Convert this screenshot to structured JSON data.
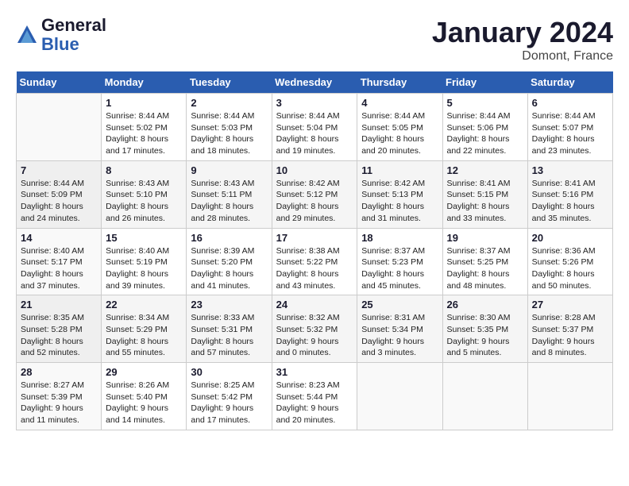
{
  "header": {
    "logo_line1": "General",
    "logo_line2": "Blue",
    "month": "January 2024",
    "location": "Domont, France"
  },
  "columns": [
    "Sunday",
    "Monday",
    "Tuesday",
    "Wednesday",
    "Thursday",
    "Friday",
    "Saturday"
  ],
  "rows": [
    [
      {
        "day": "",
        "sunrise": "",
        "sunset": "",
        "daylight": ""
      },
      {
        "day": "1",
        "sunrise": "Sunrise: 8:44 AM",
        "sunset": "Sunset: 5:02 PM",
        "daylight": "Daylight: 8 hours and 17 minutes."
      },
      {
        "day": "2",
        "sunrise": "Sunrise: 8:44 AM",
        "sunset": "Sunset: 5:03 PM",
        "daylight": "Daylight: 8 hours and 18 minutes."
      },
      {
        "day": "3",
        "sunrise": "Sunrise: 8:44 AM",
        "sunset": "Sunset: 5:04 PM",
        "daylight": "Daylight: 8 hours and 19 minutes."
      },
      {
        "day": "4",
        "sunrise": "Sunrise: 8:44 AM",
        "sunset": "Sunset: 5:05 PM",
        "daylight": "Daylight: 8 hours and 20 minutes."
      },
      {
        "day": "5",
        "sunrise": "Sunrise: 8:44 AM",
        "sunset": "Sunset: 5:06 PM",
        "daylight": "Daylight: 8 hours and 22 minutes."
      },
      {
        "day": "6",
        "sunrise": "Sunrise: 8:44 AM",
        "sunset": "Sunset: 5:07 PM",
        "daylight": "Daylight: 8 hours and 23 minutes."
      }
    ],
    [
      {
        "day": "7",
        "sunrise": "Sunrise: 8:44 AM",
        "sunset": "Sunset: 5:09 PM",
        "daylight": "Daylight: 8 hours and 24 minutes."
      },
      {
        "day": "8",
        "sunrise": "Sunrise: 8:43 AM",
        "sunset": "Sunset: 5:10 PM",
        "daylight": "Daylight: 8 hours and 26 minutes."
      },
      {
        "day": "9",
        "sunrise": "Sunrise: 8:43 AM",
        "sunset": "Sunset: 5:11 PM",
        "daylight": "Daylight: 8 hours and 28 minutes."
      },
      {
        "day": "10",
        "sunrise": "Sunrise: 8:42 AM",
        "sunset": "Sunset: 5:12 PM",
        "daylight": "Daylight: 8 hours and 29 minutes."
      },
      {
        "day": "11",
        "sunrise": "Sunrise: 8:42 AM",
        "sunset": "Sunset: 5:13 PM",
        "daylight": "Daylight: 8 hours and 31 minutes."
      },
      {
        "day": "12",
        "sunrise": "Sunrise: 8:41 AM",
        "sunset": "Sunset: 5:15 PM",
        "daylight": "Daylight: 8 hours and 33 minutes."
      },
      {
        "day": "13",
        "sunrise": "Sunrise: 8:41 AM",
        "sunset": "Sunset: 5:16 PM",
        "daylight": "Daylight: 8 hours and 35 minutes."
      }
    ],
    [
      {
        "day": "14",
        "sunrise": "Sunrise: 8:40 AM",
        "sunset": "Sunset: 5:17 PM",
        "daylight": "Daylight: 8 hours and 37 minutes."
      },
      {
        "day": "15",
        "sunrise": "Sunrise: 8:40 AM",
        "sunset": "Sunset: 5:19 PM",
        "daylight": "Daylight: 8 hours and 39 minutes."
      },
      {
        "day": "16",
        "sunrise": "Sunrise: 8:39 AM",
        "sunset": "Sunset: 5:20 PM",
        "daylight": "Daylight: 8 hours and 41 minutes."
      },
      {
        "day": "17",
        "sunrise": "Sunrise: 8:38 AM",
        "sunset": "Sunset: 5:22 PM",
        "daylight": "Daylight: 8 hours and 43 minutes."
      },
      {
        "day": "18",
        "sunrise": "Sunrise: 8:37 AM",
        "sunset": "Sunset: 5:23 PM",
        "daylight": "Daylight: 8 hours and 45 minutes."
      },
      {
        "day": "19",
        "sunrise": "Sunrise: 8:37 AM",
        "sunset": "Sunset: 5:25 PM",
        "daylight": "Daylight: 8 hours and 48 minutes."
      },
      {
        "day": "20",
        "sunrise": "Sunrise: 8:36 AM",
        "sunset": "Sunset: 5:26 PM",
        "daylight": "Daylight: 8 hours and 50 minutes."
      }
    ],
    [
      {
        "day": "21",
        "sunrise": "Sunrise: 8:35 AM",
        "sunset": "Sunset: 5:28 PM",
        "daylight": "Daylight: 8 hours and 52 minutes."
      },
      {
        "day": "22",
        "sunrise": "Sunrise: 8:34 AM",
        "sunset": "Sunset: 5:29 PM",
        "daylight": "Daylight: 8 hours and 55 minutes."
      },
      {
        "day": "23",
        "sunrise": "Sunrise: 8:33 AM",
        "sunset": "Sunset: 5:31 PM",
        "daylight": "Daylight: 8 hours and 57 minutes."
      },
      {
        "day": "24",
        "sunrise": "Sunrise: 8:32 AM",
        "sunset": "Sunset: 5:32 PM",
        "daylight": "Daylight: 9 hours and 0 minutes."
      },
      {
        "day": "25",
        "sunrise": "Sunrise: 8:31 AM",
        "sunset": "Sunset: 5:34 PM",
        "daylight": "Daylight: 9 hours and 3 minutes."
      },
      {
        "day": "26",
        "sunrise": "Sunrise: 8:30 AM",
        "sunset": "Sunset: 5:35 PM",
        "daylight": "Daylight: 9 hours and 5 minutes."
      },
      {
        "day": "27",
        "sunrise": "Sunrise: 8:28 AM",
        "sunset": "Sunset: 5:37 PM",
        "daylight": "Daylight: 9 hours and 8 minutes."
      }
    ],
    [
      {
        "day": "28",
        "sunrise": "Sunrise: 8:27 AM",
        "sunset": "Sunset: 5:39 PM",
        "daylight": "Daylight: 9 hours and 11 minutes."
      },
      {
        "day": "29",
        "sunrise": "Sunrise: 8:26 AM",
        "sunset": "Sunset: 5:40 PM",
        "daylight": "Daylight: 9 hours and 14 minutes."
      },
      {
        "day": "30",
        "sunrise": "Sunrise: 8:25 AM",
        "sunset": "Sunset: 5:42 PM",
        "daylight": "Daylight: 9 hours and 17 minutes."
      },
      {
        "day": "31",
        "sunrise": "Sunrise: 8:23 AM",
        "sunset": "Sunset: 5:44 PM",
        "daylight": "Daylight: 9 hours and 20 minutes."
      },
      {
        "day": "",
        "sunrise": "",
        "sunset": "",
        "daylight": ""
      },
      {
        "day": "",
        "sunrise": "",
        "sunset": "",
        "daylight": ""
      },
      {
        "day": "",
        "sunrise": "",
        "sunset": "",
        "daylight": ""
      }
    ]
  ]
}
